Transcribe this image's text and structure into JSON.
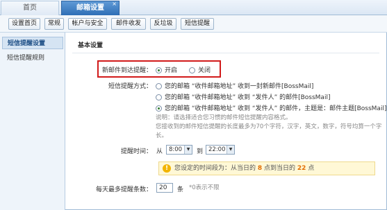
{
  "tabs": [
    {
      "label": "首页"
    },
    {
      "label": "邮箱设置",
      "close": "×"
    }
  ],
  "toolbar": {
    "buttons": [
      "设置首页",
      "常规",
      "帐户与安全",
      "邮件收发",
      "反垃圾",
      "短信提醒"
    ]
  },
  "sidebar": {
    "items": [
      {
        "label": "短信提醒设置"
      },
      {
        "label": "短信提醒规则"
      }
    ]
  },
  "main": {
    "section_title": "基本设置",
    "new_mail": {
      "label": "新邮件到达提醒：",
      "on": "开启",
      "off": "关闭",
      "selected": "开启"
    },
    "method": {
      "label": "短信提醒方式：",
      "options": [
        "您的邮箱 “收件邮箱地址” 收到一封新邮件[BossMail]",
        "您的邮箱 “收件邮箱地址” 收到 “发件人” 的邮件[BossMail]",
        "您的邮箱 “收件邮箱地址” 收到 “发件人” 的邮件，主题是：邮件主题[BossMail]"
      ],
      "selected_index": 2
    },
    "note_line1": "说明：请选择适合您习惯的邮件短信提醒内容格式。",
    "note_line2": "您接收到的邮件短信提醒的长度最多为70个字符，汉字，英文，数字，符号均算一个字",
    "note_line3": "长。",
    "time": {
      "label": "提醒时间：",
      "from": "从",
      "start": "8:00",
      "to": "到",
      "end": "22:00"
    },
    "tip": {
      "prefix": "您设定的时间段为：从当日的",
      "start_num": "8",
      "middle": "点到当日的",
      "end_num": "22",
      "suffix": "点"
    },
    "max": {
      "label": "每天最多提醒条数：",
      "value": "20",
      "unit": "条",
      "hint": "*0表示不限"
    }
  },
  "colors": {
    "highlight_border": "#d11a1a",
    "active_tab": "#2f6fb6",
    "tip_bg": "#fff8d6"
  }
}
